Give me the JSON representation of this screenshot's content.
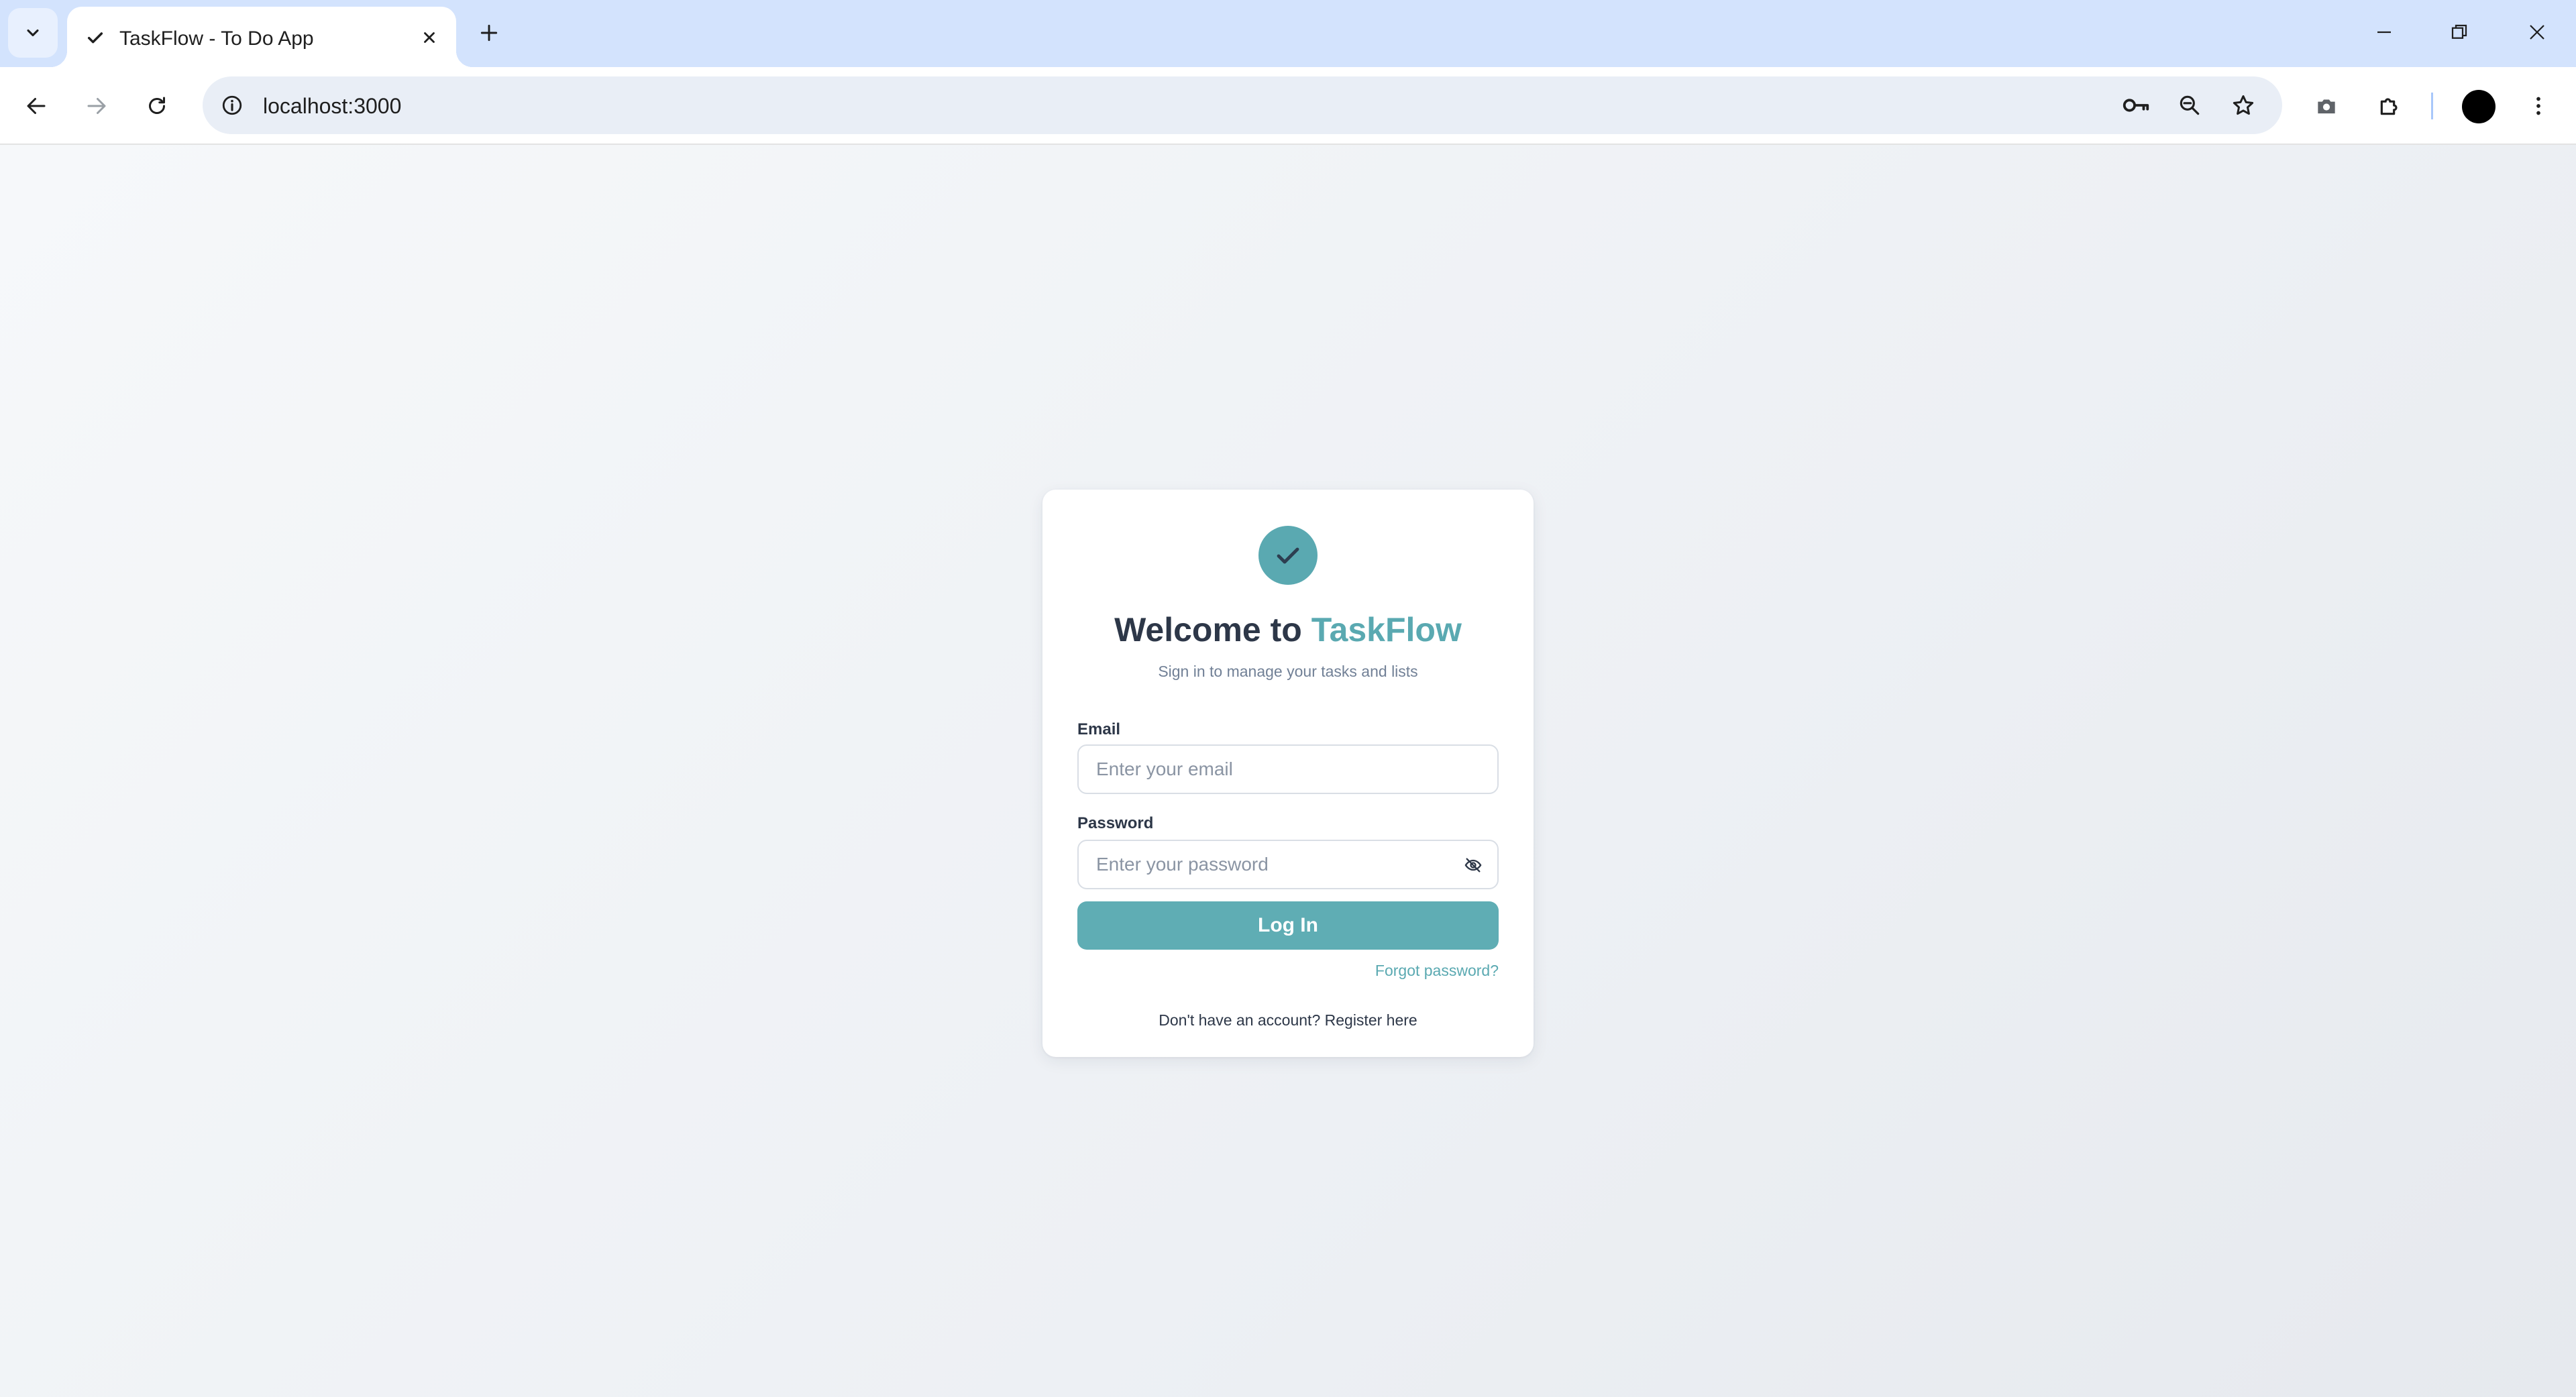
{
  "browser": {
    "tab": {
      "title": "TaskFlow - To Do App"
    },
    "address_bar": {
      "url": "localhost:3000"
    },
    "icons": {
      "tab_search": "chevron-down-icon",
      "tab_favicon": "check-icon",
      "tab_close": "close-icon",
      "new_tab": "plus-icon",
      "minimize": "minimize-icon",
      "restore": "restore-icon",
      "close_window": "close-icon",
      "back": "arrow-left-icon",
      "forward": "arrow-right-icon",
      "reload": "reload-icon",
      "site_info": "info-icon",
      "password_manager": "key-icon",
      "zoom": "zoom-icon",
      "bookmark": "star-icon",
      "screenshot": "camera-icon",
      "extensions": "puzzle-icon",
      "menu": "kebab-menu-icon"
    }
  },
  "login": {
    "logo_icon": "check-icon",
    "title_prefix": "Welcome to ",
    "title_brand": "TaskFlow",
    "subtitle": "Sign in to manage your tasks and lists",
    "email": {
      "label": "Email",
      "placeholder": "Enter your email",
      "value": ""
    },
    "password": {
      "label": "Password",
      "placeholder": "Enter your password",
      "value": "",
      "toggle_icon": "eye-off-icon"
    },
    "submit_label": "Log In",
    "forgot_label": "Forgot password?",
    "register_prompt": "Don't have an account? ",
    "register_link": "Register here"
  },
  "colors": {
    "accent": "#5aa9b1",
    "button": "#5fadb4",
    "heading": "#2d3748",
    "muted": "#718096",
    "tabstrip": "#d3e3fd"
  }
}
